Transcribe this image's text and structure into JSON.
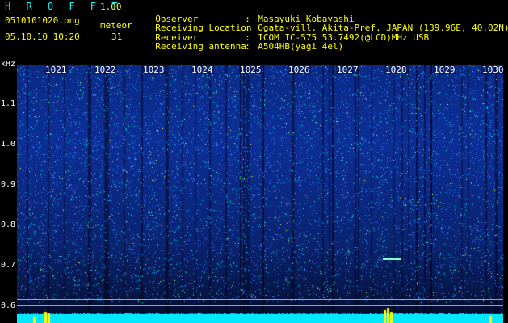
{
  "header": {
    "app_title": "H R O F F T",
    "app_version": "1.00",
    "file_name": "0510101020.png",
    "meteor_label": "meteor",
    "date_time": "05.10.10 10:20",
    "meteor_count": "31"
  },
  "info": [
    {
      "key": "Observer",
      "value": "Masayuki Kobayashi"
    },
    {
      "key": "Receiving Location",
      "value": "Ogata-vill. Akita-Pref. JAPAN (139.96E, 40.02N)"
    },
    {
      "key": "Receiver",
      "value": "ICOM IC-575 53.7492(@LCD)MHz USB"
    },
    {
      "key": "Receiving antenna",
      "value": "A504HB(yagi 4el)"
    }
  ],
  "info_separator": ":",
  "axis": {
    "unit": "kHz",
    "ticks": [
      "1.1",
      "1.0",
      "0.9",
      "0.8",
      "0.7",
      "0.6"
    ],
    "minutes": [
      "1021",
      "1022",
      "1023",
      "1024",
      "1025",
      "1026",
      "1027",
      "1028",
      "1029",
      "1030"
    ]
  },
  "colors": {
    "header_text": "#ffff00",
    "background": "#000000",
    "spectrum_low": "#0a2370",
    "spectrum_high": "#00ffff",
    "signal_bar": "#00e8ff",
    "peak": "#ffff00"
  }
}
